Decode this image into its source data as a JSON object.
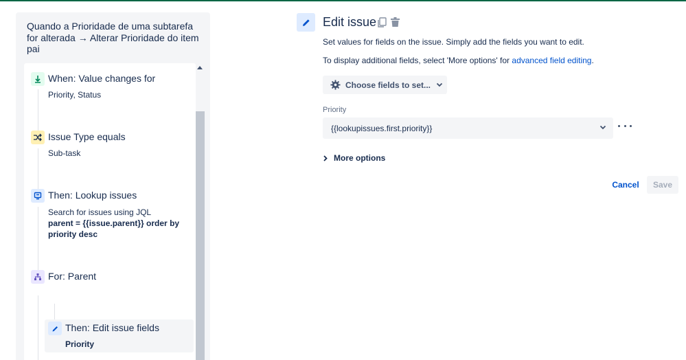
{
  "rule": {
    "title": "Quando a Prioridade de uma subtarefa for alterada → Alterar Prioridade do item pai"
  },
  "steps": [
    {
      "title": "When: Value changes for",
      "sub": "Priority, Status",
      "icon": "trigger-icon",
      "color": "#00875a"
    },
    {
      "title": "Issue Type equals",
      "sub": "Sub-task",
      "icon": "condition-icon",
      "color": "#ffab00"
    },
    {
      "title": "Then: Lookup issues",
      "sub": "Search for issues using JQL",
      "sub_bold": "parent = {{issue.parent}} order by priority desc",
      "sub_bold_line1": "parent = {{issue.parent}} order by",
      "sub_bold_line2": "priority desc",
      "icon": "lookup-icon",
      "color": "#0052cc"
    },
    {
      "title": "For: Parent",
      "icon": "branch-icon",
      "color": "#6554c0"
    },
    {
      "title": "Then: Edit issue fields",
      "sub_bold": "Priority",
      "icon": "edit-icon",
      "color": "#0052cc"
    }
  ],
  "editor": {
    "title": "Edit issue",
    "desc1": "Set values for fields on the issue. Simply add the fields you want to edit.",
    "desc2_prefix": "To display additional fields, select 'More options' for ",
    "desc2_link": "advanced field editing",
    "desc2_suffix": ".",
    "choose_label": "Choose fields to set...",
    "field_label": "Priority",
    "field_value": "{{lookupissues.first.priority}}",
    "more_options": "More options",
    "cancel": "Cancel",
    "save": "Save"
  },
  "colors": {
    "accent": "#0052cc",
    "top_bar": "#006644",
    "panel_bg": "#f4f5f7"
  }
}
